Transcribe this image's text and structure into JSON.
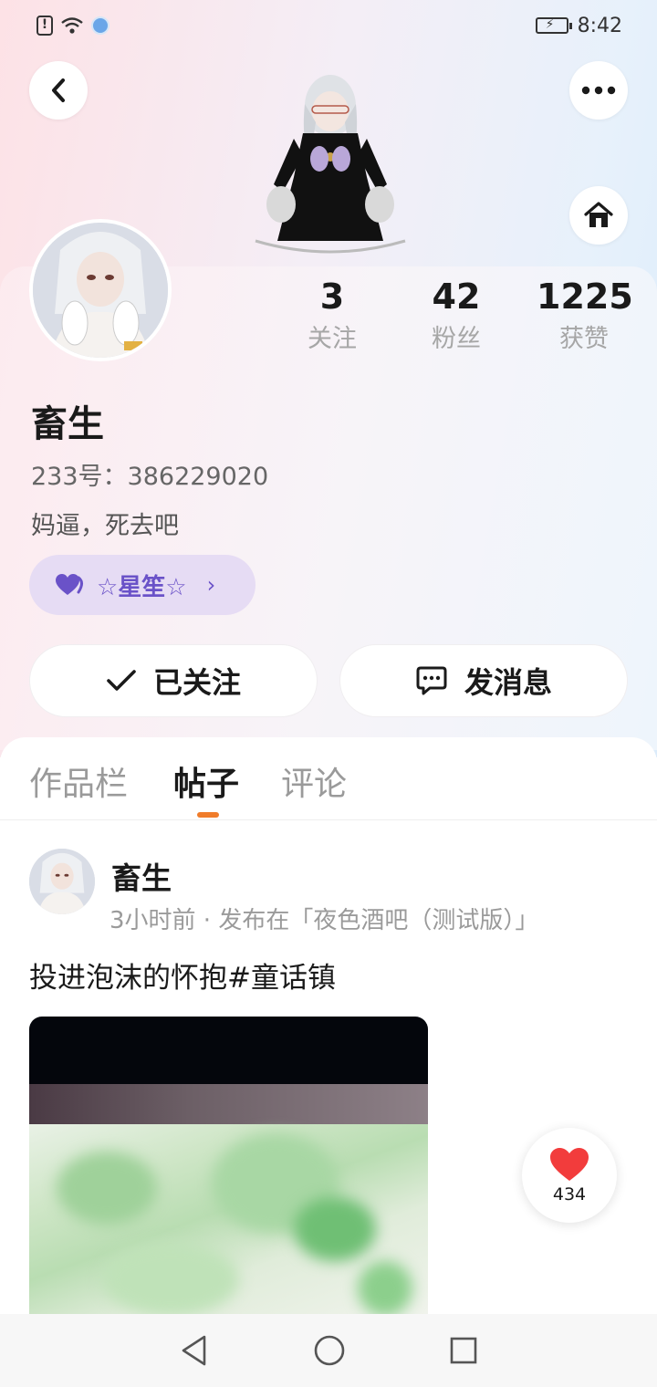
{
  "status_bar": {
    "time": "8:42"
  },
  "profile": {
    "nickname": "畜生",
    "uid_text": "233号：386229020",
    "bio": "妈逼，死去吧",
    "club": {
      "name": "☆星笙☆",
      "accent": "#6a52c8"
    }
  },
  "stats": [
    {
      "value": "3",
      "label": "关注"
    },
    {
      "value": "42",
      "label": "粉丝"
    },
    {
      "value": "1225",
      "label": "获赞"
    }
  ],
  "actions": {
    "follow_label": "已关注",
    "message_label": "发消息"
  },
  "tabs": [
    {
      "label": "作品栏",
      "active": false
    },
    {
      "label": "帖子",
      "active": true
    },
    {
      "label": "评论",
      "active": false
    }
  ],
  "post": {
    "author": "畜生",
    "meta": "3小时前 · 发布在「夜色酒吧（测试版）」",
    "text": "投进泡沫的怀抱#童话镇",
    "likes": "434"
  },
  "icons": {
    "back": "chevron-left-icon",
    "more": "more-horizontal-icon",
    "home": "home-icon",
    "club": "heart-badge-icon",
    "follow": "check-icon",
    "message": "chat-bubble-icon",
    "like": "heart-icon"
  },
  "colors": {
    "tab_indicator": "#f07c2a",
    "like_heart": "#f23c3c",
    "club_chip_bg": "#e6dcf4"
  }
}
